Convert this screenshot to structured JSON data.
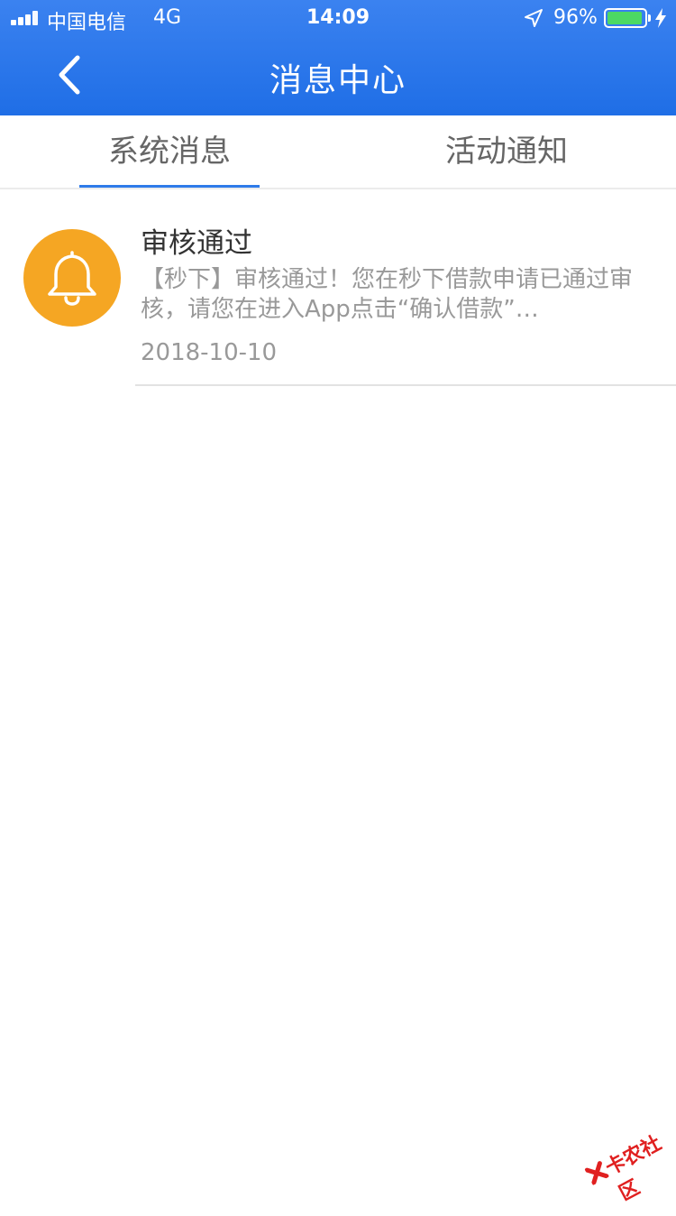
{
  "status_bar": {
    "carrier": "中国电信",
    "network": "4G",
    "time": "14:09",
    "battery_percent": "96%",
    "battery_level": 0.96,
    "signal_bars": 4
  },
  "header": {
    "title": "消息中心",
    "back_icon": "chevron-left-icon",
    "color": "#2a78ea"
  },
  "tabs": [
    {
      "label": "系统消息",
      "active": true
    },
    {
      "label": "活动通知",
      "active": false
    }
  ],
  "messages": [
    {
      "icon": "bell-icon",
      "icon_color": "#f5a623",
      "title": "审核通过",
      "body": "【秒下】审核通过！您在秒下借款申请已通过审核，请您在进入App点击“确认借款”…",
      "date": "2018-10-10"
    }
  ],
  "watermark": {
    "text": "卡农社区"
  }
}
